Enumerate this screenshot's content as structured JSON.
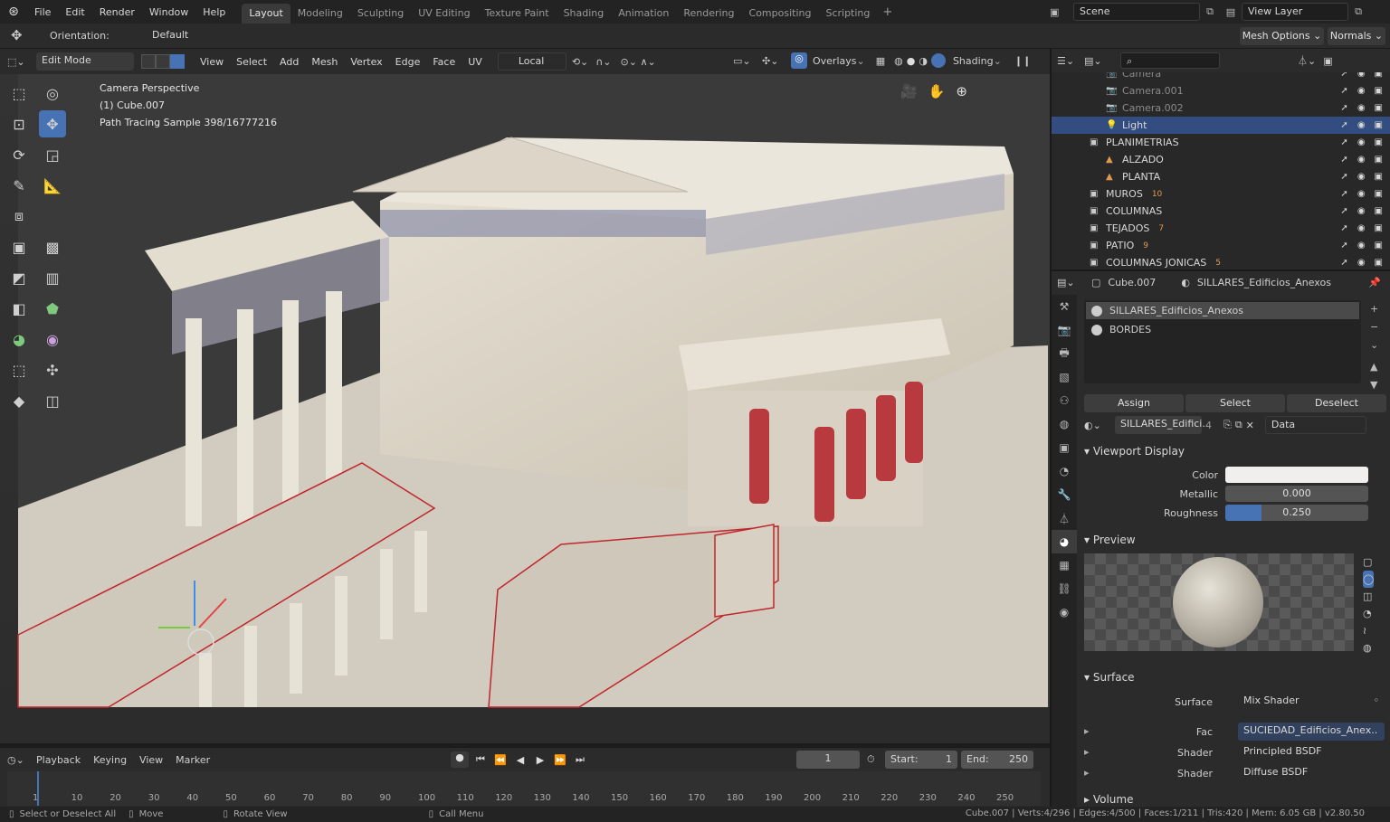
{
  "menu": [
    "File",
    "Edit",
    "Render",
    "Window",
    "Help"
  ],
  "workspaces": [
    "Layout",
    "Modeling",
    "Sculpting",
    "UV Editing",
    "Texture Paint",
    "Shading",
    "Animation",
    "Rendering",
    "Compositing",
    "Scripting"
  ],
  "active_workspace": "Layout",
  "scene": {
    "name": "Scene",
    "view_layer": "View Layer"
  },
  "header2": {
    "orientation_label": "Orientation:",
    "orientation_value": "Default",
    "mesh_options": "Mesh Options",
    "normals": "Normals"
  },
  "viewport_header": {
    "mode": "Edit Mode",
    "menus": [
      "View",
      "Select",
      "Add",
      "Mesh",
      "Vertex",
      "Edge",
      "Face",
      "UV"
    ],
    "transform": "Local",
    "overlays": "Overlays",
    "shading": "Shading"
  },
  "viewport_overlay": {
    "line1": "Camera Perspective",
    "line2": "(1) Cube.007",
    "line3": "Path Tracing Sample 398/16777216"
  },
  "outliner": {
    "rows": [
      {
        "label": "Camera",
        "dim": true
      },
      {
        "label": "Camera.001",
        "dim": true
      },
      {
        "label": "Camera.002",
        "dim": true
      },
      {
        "label": "Light",
        "selected": true
      },
      {
        "label": "PLANIMETRIAS"
      },
      {
        "label": "ALZADO"
      },
      {
        "label": "PLANTA"
      },
      {
        "label": "MUROS",
        "badge": "10"
      },
      {
        "label": "COLUMNAS"
      },
      {
        "label": "TEJADOS",
        "badge": "7"
      },
      {
        "label": "PATIO",
        "badge": "9"
      },
      {
        "label": "COLUMNAS JONICAS",
        "badge": "5"
      }
    ]
  },
  "properties": {
    "object": "Cube.007",
    "material": "SILLARES_Edificios_Anexos",
    "slots": [
      "SILLARES_Edificios_Anexos",
      "BORDES"
    ],
    "assign": "Assign",
    "select": "Select",
    "deselect": "Deselect",
    "mat_field": "SILLARES_Edifici..",
    "mat_users": "4",
    "link": "Data",
    "viewport_display": "Viewport Display",
    "color_label": "Color",
    "metallic_label": "Metallic",
    "metallic_value": "0.000",
    "roughness_label": "Roughness",
    "roughness_value": "0.250",
    "roughness_fraction": 0.25,
    "preview": "Preview",
    "surface_section": "Surface",
    "surface_label": "Surface",
    "surface_value": "Mix Shader",
    "fac_label": "Fac",
    "fac_value": "SUCIEDAD_Edificios_Anex..",
    "shader_label": "Shader",
    "shader1": "Principled BSDF",
    "shader2": "Diffuse BSDF",
    "volume": "Volume"
  },
  "timeline": {
    "menus": [
      "Playback",
      "Keying",
      "View",
      "Marker"
    ],
    "current_frame": "1",
    "start_label": "Start:",
    "start": "1",
    "end_label": "End:",
    "end": "250",
    "ticks": [
      "1",
      "10",
      "20",
      "30",
      "40",
      "50",
      "60",
      "70",
      "80",
      "90",
      "100",
      "110",
      "120",
      "130",
      "140",
      "150",
      "160",
      "170",
      "180",
      "190",
      "200",
      "210",
      "220",
      "230",
      "240",
      "250"
    ]
  },
  "statusbar": {
    "select": "Select or Deselect All",
    "move": "Move",
    "rotate": "Rotate View",
    "call": "Call Menu",
    "stats": "Cube.007 | Verts:4/296 | Edges:4/500 | Faces:1/211 | Tris:420 | Mem: 6.05 GB | v2.80.50"
  },
  "colors": {
    "accent": "#4772b3",
    "selected_row": "#334d80",
    "edge_red": "#c0262b"
  }
}
